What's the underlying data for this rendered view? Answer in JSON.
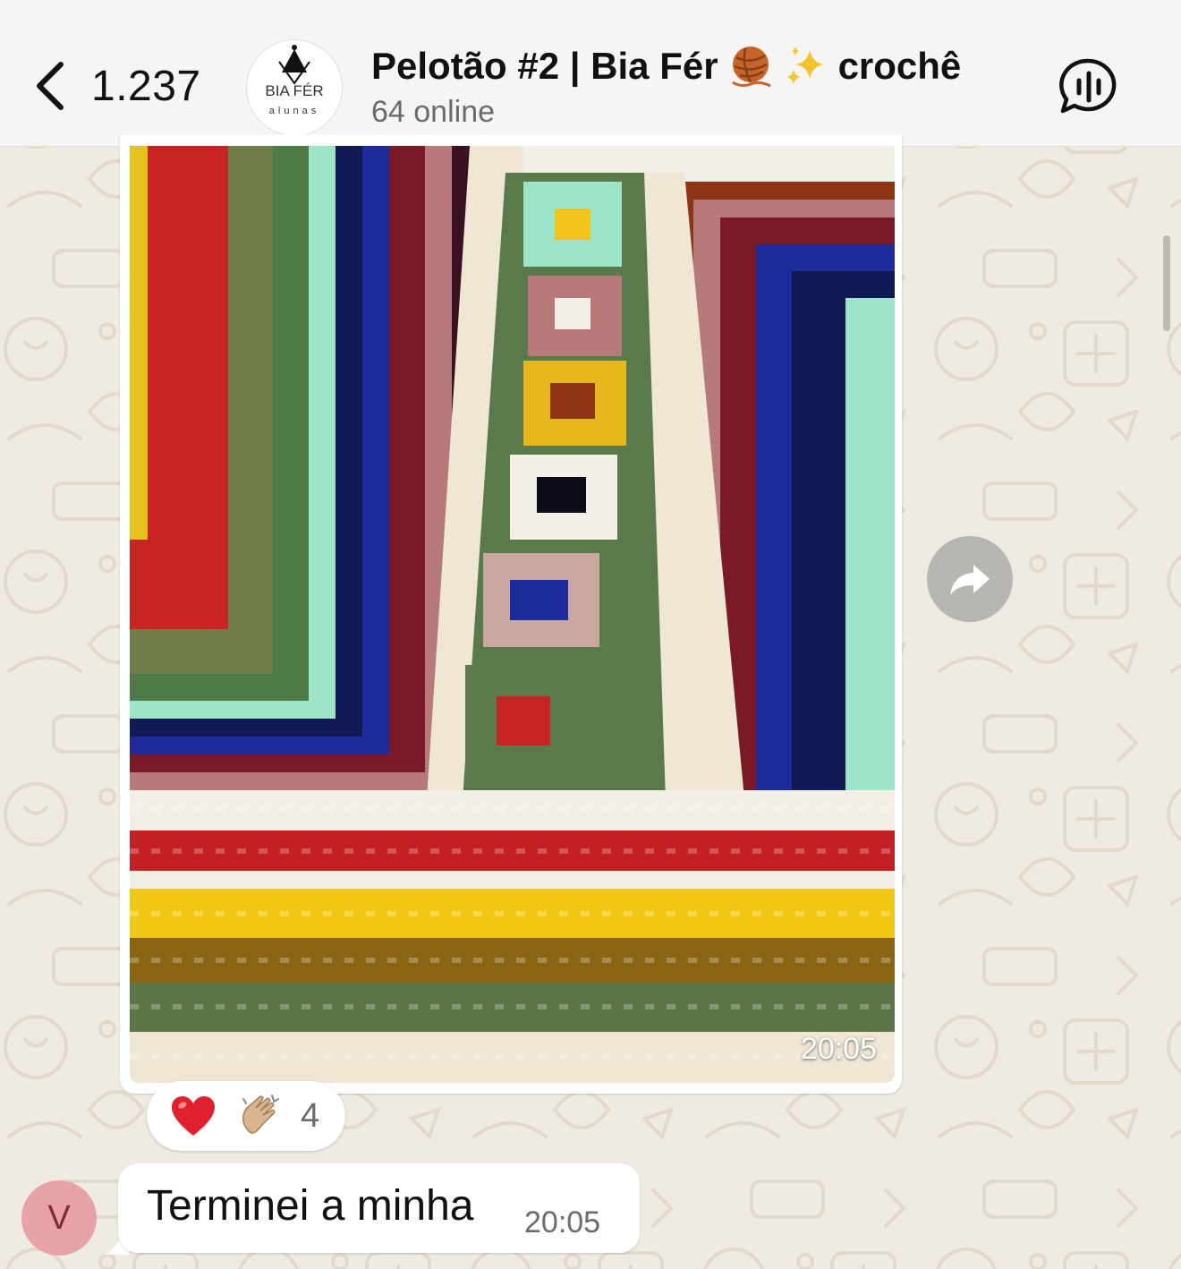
{
  "header": {
    "back_count": "1.237",
    "group_title": "Pelotão #2 | Bia Fér",
    "group_title_suffix": "crochê",
    "title_emojis": [
      "yarn-ball",
      "sparkles"
    ],
    "status": "64 online",
    "avatar_text_top": "BIA FÉR",
    "avatar_text_bottom": "alunas"
  },
  "messages": [
    {
      "type": "image",
      "subject": "crochet granny square vest",
      "time": "20:05",
      "reactions": {
        "emojis": [
          "red-heart",
          "clapping-hands"
        ],
        "count": "4"
      }
    },
    {
      "type": "text",
      "sender_initial": "V",
      "text": "Terminei a minha",
      "time": "20:05"
    }
  ],
  "colors": {
    "background": "#efeae2",
    "header": "#f6f5f3",
    "bubble": "#ffffff",
    "avatar": "#e8a3a8",
    "forward_button": "#b8b6b2"
  }
}
